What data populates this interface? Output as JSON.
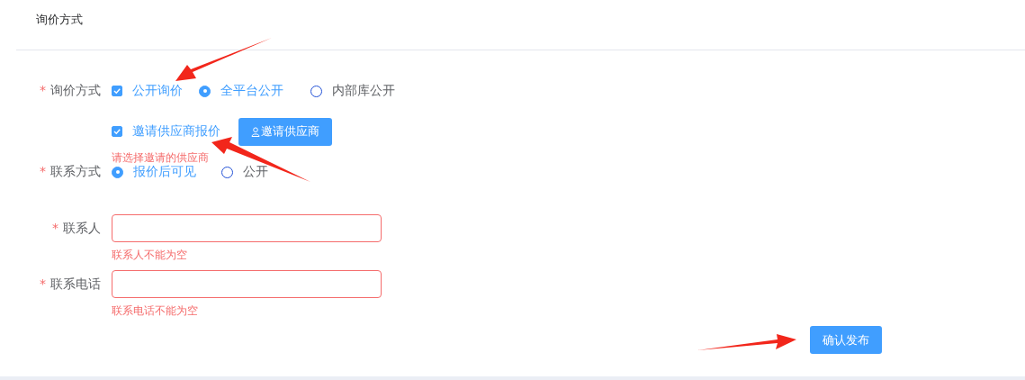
{
  "section_title": "询价方式",
  "inquiry": {
    "label": "询价方式",
    "required_mark": "*",
    "options": [
      {
        "kind": "checkbox",
        "label": "公开询价",
        "checked": true
      },
      {
        "kind": "radio",
        "label": "全平台公开",
        "selected": true
      },
      {
        "kind": "radio",
        "label": "内部库公开",
        "selected": false
      }
    ]
  },
  "invite": {
    "label": "邀请供应商报价",
    "checked": true,
    "button": "邀请供应商",
    "error": "请选择邀请的供应商"
  },
  "contact_mode": {
    "label": "联系方式",
    "required_mark": "*",
    "options": [
      {
        "label": "报价后可见",
        "selected": true
      },
      {
        "label": "公开",
        "selected": false
      }
    ]
  },
  "fields": [
    {
      "label": "联系人",
      "required_mark": "*",
      "error": "联系人不能为空"
    },
    {
      "label": "联系电话",
      "required_mark": "*",
      "error": "联系电话不能为空"
    }
  ],
  "submit": "确认发布"
}
